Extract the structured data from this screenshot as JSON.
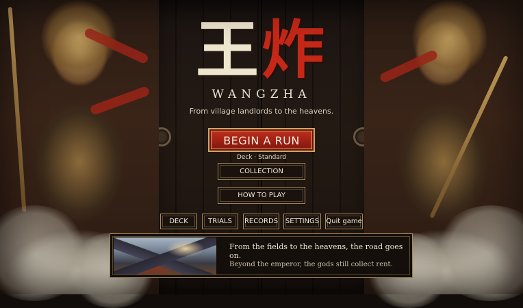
{
  "logo": {
    "char1": "王",
    "char2": "炸",
    "wordmark": "WANGZHA"
  },
  "tagline": "From village landlords to the heavens.",
  "menu": {
    "primary_label": "BEGIN A RUN",
    "deck_prefix": "Deck",
    "deck_separator": "·",
    "deck_value": "Standard",
    "collection_label": "COLLECTION",
    "how_to_play_label": "HOW TO PLAY"
  },
  "bottom_menu": [
    {
      "label": "DECK"
    },
    {
      "label": "TRIALS"
    },
    {
      "label": "RECORDS"
    },
    {
      "label": "SETTINGS"
    },
    {
      "label": "Quit game"
    }
  ],
  "panel": {
    "line1": "From the fields to the heavens, the road goes on.",
    "line2": "Beyond the emperor, the gods still collect rent."
  },
  "colors": {
    "primary_button": "#b2261a",
    "logo_red": "#c62818",
    "logo_cream": "#efe6cf",
    "frame_gold": "#a88a5a"
  }
}
